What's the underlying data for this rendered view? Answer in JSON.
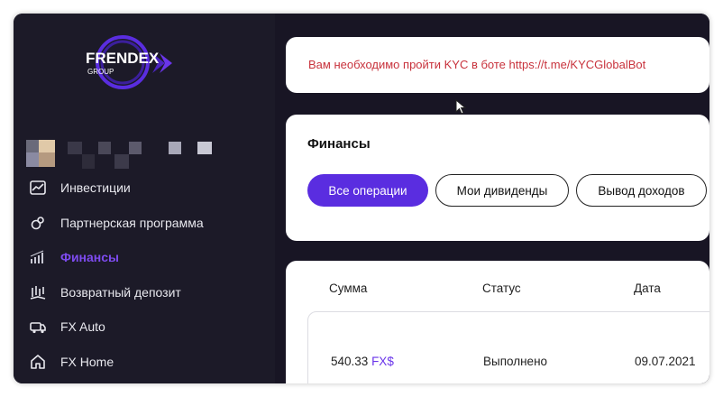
{
  "brand": {
    "name": "FRENDEX",
    "sub": "GROUP"
  },
  "nav": [
    {
      "label": "Инвестиции",
      "icon": "chart-line-icon",
      "active": false
    },
    {
      "label": "Партнерская программа",
      "icon": "partner-link-icon",
      "active": false
    },
    {
      "label": "Финансы",
      "icon": "finance-bars-icon",
      "active": true
    },
    {
      "label": "Возвратный депозит",
      "icon": "deposit-return-icon",
      "active": false
    },
    {
      "label": "FX Auto",
      "icon": "car-icon",
      "active": false
    },
    {
      "label": "FX Home",
      "icon": "home-icon",
      "active": false
    }
  ],
  "alert": {
    "text": "Вам необходимо пройти KYC в боте https://t.me/KYCGlobalBot"
  },
  "finance": {
    "title": "Финансы",
    "tabs": [
      {
        "label": "Все операции",
        "active": true
      },
      {
        "label": "Мои дивиденды",
        "active": false
      },
      {
        "label": "Вывод доходов",
        "active": false
      }
    ]
  },
  "table": {
    "headers": [
      "Сумма",
      "Статус",
      "Дата"
    ],
    "rows": [
      {
        "amount": "540.33",
        "currency": "FX$",
        "status": "Выполнено",
        "date": "09.07.2021"
      }
    ]
  },
  "colors": {
    "accent": "#5a2de0",
    "alert": "#c8323c",
    "sidebar": "#1c1a28"
  }
}
